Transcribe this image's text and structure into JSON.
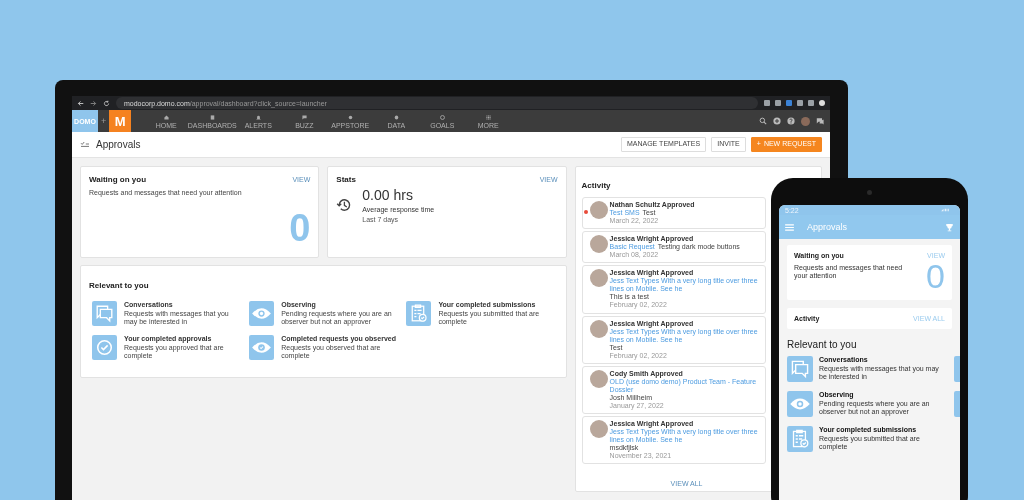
{
  "browser": {
    "url_host": "modocorp.domo.com",
    "url_path": "/approval/dashboard?click_source=launcher"
  },
  "nav": {
    "logo": "DOMO",
    "plus": "+",
    "app_logo": "M",
    "items": [
      {
        "label": "HOME",
        "kind": "home"
      },
      {
        "label": "DASHBOARDS",
        "kind": "pages"
      },
      {
        "label": "ALERTS",
        "kind": "bell"
      },
      {
        "label": "BUZZ",
        "kind": "chat"
      },
      {
        "label": "APPSTORE",
        "kind": "store"
      },
      {
        "label": "DATA",
        "kind": "data"
      },
      {
        "label": "GOALS",
        "kind": "goal"
      },
      {
        "label": "MORE",
        "kind": "grid"
      }
    ]
  },
  "header": {
    "title": "Approvals",
    "buttons": [
      {
        "label": "MANAGE TEMPLATES",
        "kind": "outline"
      },
      {
        "label": "INVITE",
        "kind": "outline"
      },
      {
        "label": "NEW REQUEST",
        "kind": "primary",
        "icon": "+"
      }
    ]
  },
  "waiting": {
    "title": "Waiting on you",
    "link": "VIEW",
    "description": "Requests and messages that need your attention",
    "count": "0"
  },
  "stats": {
    "title": "Stats",
    "link": "VIEW",
    "value": "0.00 hrs",
    "label": "Average response time",
    "period": "Last 7 days"
  },
  "relevant": {
    "title": "Relevant to you",
    "items": [
      {
        "kind": "chat",
        "title": "Conversations",
        "description": "Requests with messages that you may be interested in"
      },
      {
        "kind": "eye",
        "title": "Observing",
        "description": "Pending requests where you are an observer but not an approver"
      },
      {
        "kind": "clipboard",
        "title": "Your completed submissions",
        "description": "Requests you submitted that are complete"
      },
      {
        "kind": "check",
        "title": "Your completed approvals",
        "description": "Requests you approved that are complete"
      },
      {
        "kind": "eyecheck",
        "title": "Completed requests you observed",
        "description": "Requests you observed that are complete"
      }
    ]
  },
  "activity": {
    "title": "Activity",
    "view_all": "VIEW ALL",
    "items": [
      {
        "heading": "Nathan Schultz Approved",
        "link": "Test SMS",
        "note": "Test",
        "date": "March 22, 2022",
        "unread": true,
        "kind": "inline"
      },
      {
        "heading": "Jessica Wright Approved",
        "link": "Basic Request",
        "note": "Testing dark mode buttons",
        "date": "March 08, 2022",
        "unread": false,
        "kind": "inline"
      },
      {
        "heading": "Jessica Wright Approved",
        "link": "Jess Text Types With a very long title over three lines on Mobile. See he",
        "note": "This is a test",
        "date": "February 02, 2022",
        "unread": false,
        "kind": "below"
      },
      {
        "heading": "Jessica Wright Approved",
        "link": "Jess Text Types With a very long title over three lines on Mobile. See he",
        "note": "Test",
        "date": "February 02, 2022",
        "unread": false,
        "kind": "below"
      },
      {
        "heading": "Cody Smith Approved",
        "link": "OLD (use domo demo) Product Team - Feature Dossier",
        "note": "Josh Millheim",
        "date": "January 27, 2022",
        "unread": false,
        "kind": "inline"
      },
      {
        "heading": "Jessica Wright Approved",
        "link": "Jess Text Types With a very long title over three lines on Mobile. See he",
        "note": "msdkfjlsk",
        "date": "November 23, 2021",
        "unread": false,
        "kind": "below"
      }
    ]
  },
  "phone": {
    "time": "5:22",
    "title": "Approvals",
    "waiting": {
      "title": "Waiting on you",
      "link": "VIEW",
      "description": "Requests and messages that need your attention",
      "count": "0"
    },
    "activity": {
      "title": "Activity",
      "link": "VIEW ALL"
    },
    "relevant": {
      "title": "Relevant to you",
      "items": [
        {
          "kind": "chat",
          "title": "Conversations",
          "description": "Requests with messages that you may be interested in"
        },
        {
          "kind": "eye",
          "title": "Observing",
          "description": "Pending requests where you are an observer but not an approver"
        },
        {
          "kind": "clipboard",
          "title": "Your completed submissions",
          "description": "Requests you submitted that are complete"
        }
      ]
    }
  }
}
